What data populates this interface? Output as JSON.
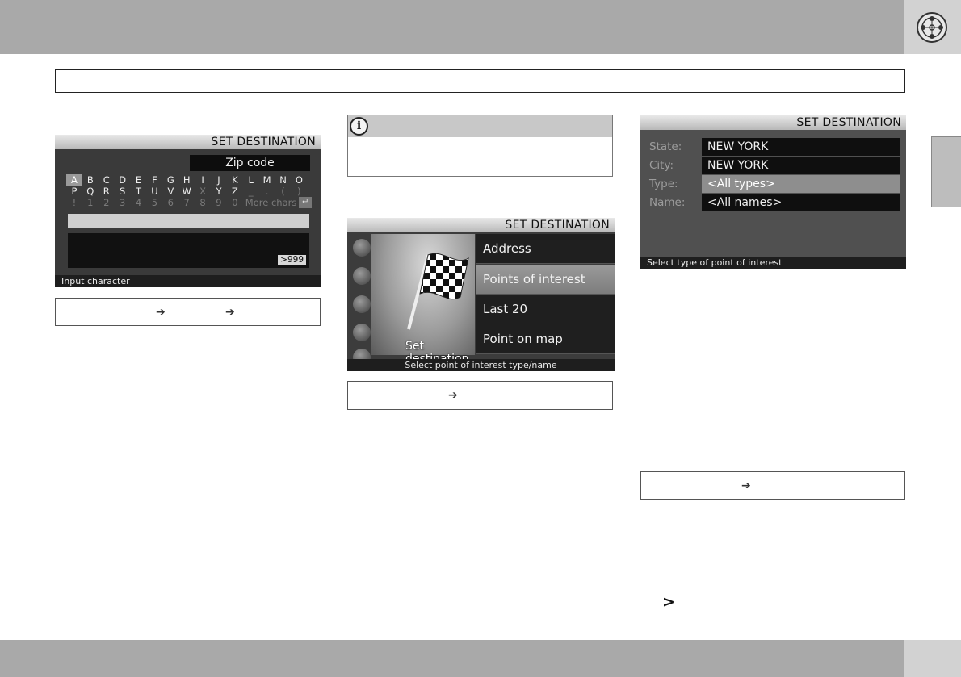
{
  "colors": {
    "band": "#a9a9a9",
    "band_corner": "#d2d2d2",
    "screen_bg": "#3a3a3a",
    "highlight": "#8e8e8e"
  },
  "header": {
    "logo_icon": "wheel-logo-icon",
    "title": ""
  },
  "screen1": {
    "header": "SET DESTINATION",
    "field_label": "Zip code",
    "keys_row1": [
      "A",
      "B",
      "C",
      "D",
      "E",
      "F",
      "G",
      "H",
      "I",
      "J",
      "K",
      "L",
      "M",
      "N",
      "O"
    ],
    "keys_row2": [
      "P",
      "Q",
      "R",
      "S",
      "T",
      "U",
      "V",
      "W",
      "X",
      "Y",
      "Z",
      "_",
      ".",
      "(",
      ")"
    ],
    "keys_row3": [
      "!",
      "1",
      "2",
      "3",
      "4",
      "5",
      "6",
      "7",
      "8",
      "9",
      "0"
    ],
    "more_chars": "More chars",
    "enter_key": "↵",
    "count": ">999",
    "status": "Input character"
  },
  "path1": {
    "arrow": "➔"
  },
  "note": {
    "icon_letter": "i"
  },
  "screen2": {
    "header": "SET DESTINATION",
    "flag_label": "Set destination",
    "menu": [
      "Address",
      "Points of interest",
      "Last 20",
      "Point on map"
    ],
    "active_index": 1,
    "status": "Select point of interest type/name"
  },
  "path2": {
    "arrow": "➔"
  },
  "screen3": {
    "header": "SET DESTINATION",
    "rows": [
      {
        "label": "State:",
        "value": "NEW YORK"
      },
      {
        "label": "City:",
        "value": "NEW YORK"
      },
      {
        "label": "Type:",
        "value": "<All types>"
      },
      {
        "label": "Name:",
        "value": "<All names>"
      }
    ],
    "highlight_index": 2,
    "status": "Select type of point of interest"
  },
  "path3": {
    "arrow": "➔"
  },
  "continue_mark": ">"
}
